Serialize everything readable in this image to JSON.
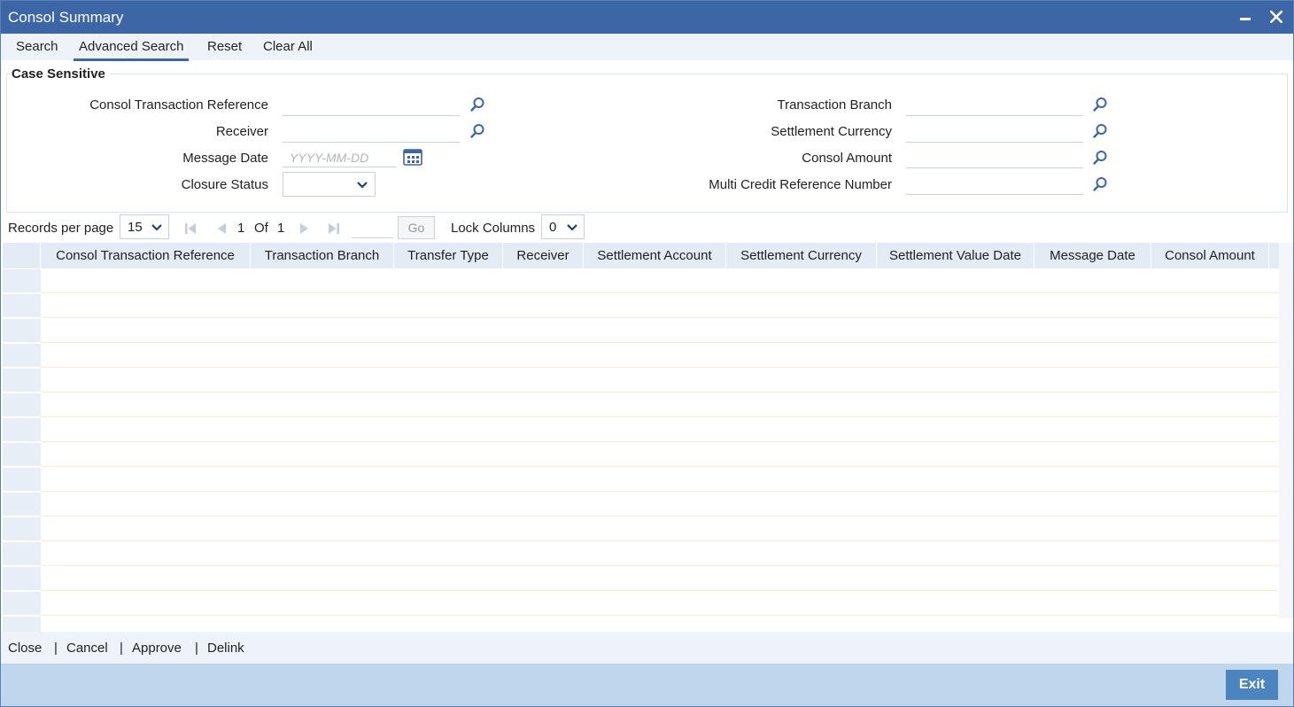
{
  "window": {
    "title": "Consol Summary"
  },
  "toolbar": {
    "search": "Search",
    "advanced_search": "Advanced Search",
    "reset": "Reset",
    "clear_all": "Clear All"
  },
  "criteria": {
    "title": "Case Sensitive",
    "left": {
      "consol_ref_label": "Consol Transaction Reference",
      "receiver_label": "Receiver",
      "message_date_label": "Message Date",
      "message_date_placeholder": "YYYY-MM-DD",
      "closure_status_label": "Closure Status",
      "closure_status_value": ""
    },
    "right": {
      "txn_branch_label": "Transaction Branch",
      "settlement_currency_label": "Settlement Currency",
      "consol_amount_label": "Consol Amount",
      "multi_credit_label": "Multi Credit Reference Number"
    }
  },
  "pager": {
    "records_label": "Records per page",
    "records_value": "15",
    "current_page": "1",
    "of_label": "Of",
    "total_pages": "1",
    "go_label": "Go",
    "lock_label": "Lock Columns",
    "lock_value": "0"
  },
  "grid": {
    "columns": [
      "Consol Transaction Reference",
      "Transaction Branch",
      "Transfer Type",
      "Receiver",
      "Settlement Account",
      "Settlement Currency",
      "Settlement Value Date",
      "Message Date",
      "Consol Amount"
    ]
  },
  "footer": {
    "close": "Close",
    "cancel": "Cancel",
    "approve": "Approve",
    "delink": "Delink",
    "exit": "Exit"
  },
  "colors": {
    "titlebar": "#3d66a6",
    "accent": "#4b85c0",
    "footer_bar": "#bfd6ec"
  }
}
